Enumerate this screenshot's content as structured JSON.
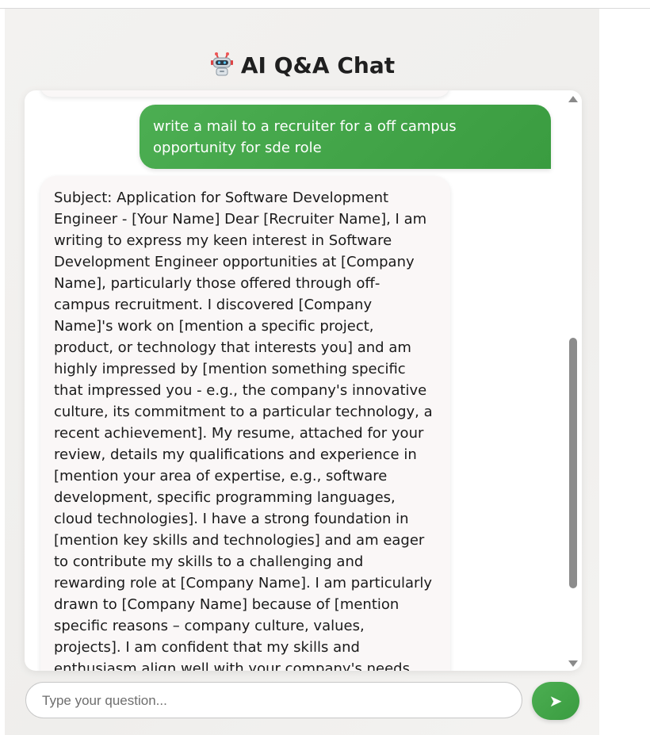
{
  "app": {
    "title": "AI Q&A Chat",
    "title_icon": "robot-icon"
  },
  "messages": [
    {
      "role": "user",
      "text": "write a mail to a recruiter for a off campus opportunity for sde role"
    },
    {
      "role": "bot",
      "text": "Subject: Application for Software Development Engineer - [Your Name] Dear [Recruiter Name], I am writing to express my keen interest in Software Development Engineer opportunities at [Company Name], particularly those offered through off-campus recruitment. I discovered [Company Name]'s work on [mention a specific project, product, or technology that interests you] and am highly impressed by [mention something specific that impressed you - e.g., the company's innovative culture, its commitment to a particular technology, a recent achievement]. My resume, attached for your review, details my qualifications and experience in [mention your area of expertise, e.g., software development, specific programming languages, cloud technologies]. I have a strong foundation in [mention key skills and technologies] and am eager to contribute my skills to a challenging and rewarding role at [Company Name]. I am particularly drawn to [Company Name] because of [mention specific reasons – company culture, values, projects]. I am confident that my skills and enthusiasm align well with your company's needs and would be a valuable asset to your team. Thank you for"
    }
  ],
  "input": {
    "placeholder": "Type your question...",
    "value": ""
  },
  "send_button": {
    "label": "➤",
    "icon": "send-icon"
  },
  "colors": {
    "accent": "#43a748",
    "bubble_bot": "#faf7f7",
    "scroll_thumb": "#8c8c8c"
  }
}
